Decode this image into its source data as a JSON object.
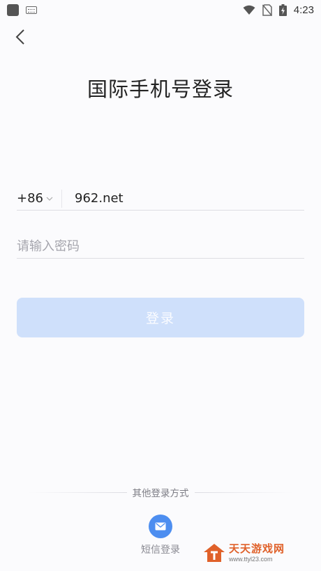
{
  "status_bar": {
    "time": "4:23",
    "icons": [
      "app-icon",
      "keyboard-icon",
      "wifi-icon",
      "no-sim-icon",
      "battery-charging-icon"
    ]
  },
  "header": {
    "back_icon": "chevron-left-icon",
    "title": "国际手机号登录"
  },
  "form": {
    "country_code": "+86",
    "phone_value": "962.net",
    "password_placeholder": "请输入密码",
    "login_label": "登录"
  },
  "other": {
    "label": "其他登录方式",
    "sms_label": "短信登录",
    "sms_icon": "message-icon"
  },
  "watermark": {
    "title": "天天游戏网",
    "url": "www.ttyl23.com"
  },
  "colors": {
    "accent": "#4d8ef0",
    "button_disabled": "#cfe0fb",
    "watermark": "#e0612a"
  }
}
